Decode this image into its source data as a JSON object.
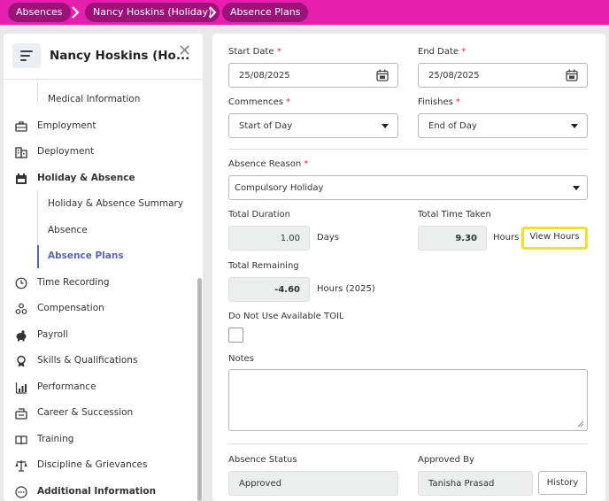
{
  "breadcrumb": {
    "items": [
      "Absences",
      "Nancy Hoskins (Holiday)",
      "Absence Plans"
    ]
  },
  "sidebar": {
    "title": "Nancy Hoskins (Ho...",
    "items": [
      {
        "label": "Medical Information",
        "icon": "none"
      },
      {
        "label": "Employment",
        "icon": "briefcase-icon"
      },
      {
        "label": "Deployment",
        "icon": "building-icon"
      },
      {
        "label": "Holiday & Absence",
        "icon": "calendar-icon"
      },
      {
        "label": "Holiday & Absence Summary",
        "icon": "none"
      },
      {
        "label": "Absence",
        "icon": "none"
      },
      {
        "label": "Absence Plans",
        "icon": "none"
      },
      {
        "label": "Time Recording",
        "icon": "clock-icon"
      },
      {
        "label": "Compensation",
        "icon": "coins-icon"
      },
      {
        "label": "Payroll",
        "icon": "piggy-bank-icon"
      },
      {
        "label": "Skills & Qualifications",
        "icon": "award-icon"
      },
      {
        "label": "Performance",
        "icon": "bar-chart-icon"
      },
      {
        "label": "Career & Succession",
        "icon": "career-icon"
      },
      {
        "label": "Training",
        "icon": "book-icon"
      },
      {
        "label": "Discipline & Grievances",
        "icon": "scales-icon"
      },
      {
        "label": "Additional Information",
        "icon": "more-icon"
      }
    ]
  },
  "form": {
    "start_date": {
      "label": "Start Date",
      "required": "*",
      "value": "25/08/2025"
    },
    "end_date": {
      "label": "End Date",
      "required": "*",
      "value": "25/08/2025"
    },
    "commences": {
      "label": "Commences",
      "required": "*",
      "value": "Start of Day"
    },
    "finishes": {
      "label": "Finishes",
      "required": "*",
      "value": "End of Day"
    },
    "absence_reason": {
      "label": "Absence Reason",
      "required": "*",
      "value": "Compulsory Holiday"
    },
    "total_duration": {
      "label": "Total Duration",
      "value": "1.00",
      "unit": "Days"
    },
    "total_time_taken": {
      "label": "Total Time Taken",
      "value": "9.30",
      "unit": "Hours",
      "button": "View Hours"
    },
    "total_remaining": {
      "label": "Total Remaining",
      "value": "-4.60",
      "unit": "Hours (2025)"
    },
    "toil": {
      "label": "Do Not Use Available TOIL"
    },
    "notes": {
      "label": "Notes",
      "value": ""
    },
    "absence_status": {
      "label": "Absence Status",
      "value": "Approved"
    },
    "approved_by": {
      "label": "Approved By",
      "value": "Tanisha Prasad",
      "button": "History"
    }
  },
  "colors": {
    "brand": "#e61fae",
    "crumb": "#9c1279",
    "active": "#5a64a6",
    "highlight": "#f1e12a"
  }
}
